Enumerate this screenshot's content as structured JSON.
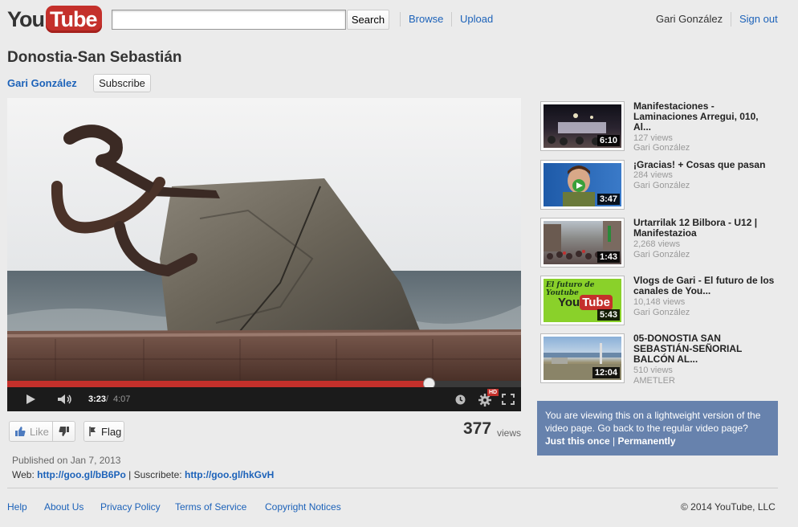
{
  "header": {
    "logo_you": "You",
    "logo_tube": "Tube",
    "search_value": "",
    "search_button": "Search",
    "nav": [
      "Browse",
      "Upload"
    ],
    "user_name": "Gari González",
    "sign_out": "Sign out"
  },
  "video": {
    "title": "Donostia-San Sebastián",
    "channel": "Gari González",
    "subscribe": "Subscribe",
    "time_current": "3:23",
    "time_separator": "/",
    "time_total": "4:07",
    "progress": 0.82,
    "hd_badge": "HD"
  },
  "actions": {
    "like": "Like",
    "flag": "Flag",
    "view_count": "377",
    "view_label": "views"
  },
  "description": {
    "published": "Published on Jan 7, 2013",
    "web_label": "Web:",
    "web_link": "http://goo.gl/bB6Po",
    "separator": "|",
    "subscribe_label": "Suscribete:",
    "subscribe_link": "http://goo.gl/hkGvH"
  },
  "related": [
    {
      "title": "Manifestaciones - Laminaciones Arregui, 010, Al...",
      "views": "127 views",
      "author": "Gari González",
      "duration": "6:10"
    },
    {
      "title": "¡Gracias! + Cosas que pasan",
      "views": "284 views",
      "author": "Gari González",
      "duration": "3:47"
    },
    {
      "title": "Urtarrilak 12 Bilbora - U12 | Manifestazioa",
      "views": "2,268 views",
      "author": "Gari González",
      "duration": "1:43"
    },
    {
      "title": "Vlogs de Gari - El futuro de los canales de You...",
      "views": "10,148 views",
      "author": "Gari González",
      "duration": "5:43",
      "thumb_text_top": "El futuro de Youtube",
      "thumb_logo_you": "You",
      "thumb_logo_tube": "Tube"
    },
    {
      "title": "05-DONOSTIA SAN SEBASTIÁN-SEÑORIAL BALCÓN AL...",
      "views": "510 views",
      "author": "AMETLER",
      "duration": "12:04"
    }
  ],
  "notice": {
    "text": "You are viewing this on a lightweight version of the video page. Go back to the regular video page?",
    "just_once": "Just this once",
    "separator": "|",
    "permanently": "Permanently"
  },
  "footer": {
    "links": [
      "Help",
      "About Us",
      "Privacy Policy",
      "Terms of Service",
      "Copyright Notices"
    ],
    "copyright": "© 2014 YouTube, LLC"
  },
  "colors": {
    "brand_red": "#c4302b",
    "link_blue": "#1c62b9",
    "notice_bg": "#6782ad",
    "page_bg": "#ebebeb"
  }
}
